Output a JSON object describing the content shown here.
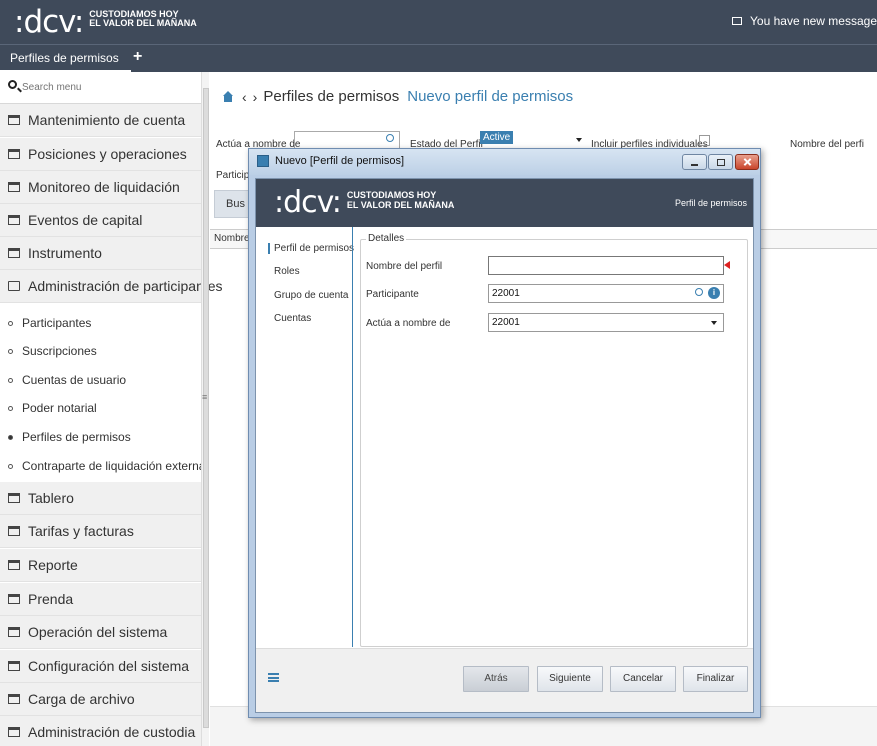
{
  "header": {
    "logo_text": ":dcv:",
    "tagline_line1": "CUSTODIAMOS HOY",
    "tagline_line2": "EL VALOR DEL MAÑANA",
    "messages": "You have new message"
  },
  "tabs": [
    {
      "label": "Perfiles de permisos"
    }
  ],
  "tab_add": "+",
  "sidebar": {
    "search_placeholder": "Search menu",
    "items": [
      {
        "label": "Mantenimiento de cuenta"
      },
      {
        "label": "Posiciones y operaciones"
      },
      {
        "label": "Monitoreo de liquidación"
      },
      {
        "label": "Eventos de capital"
      },
      {
        "label": "Instrumento"
      },
      {
        "label": "Administración de participantes"
      },
      {
        "label": "Tablero"
      },
      {
        "label": "Tarifas y facturas"
      },
      {
        "label": "Reporte"
      },
      {
        "label": "Prenda"
      },
      {
        "label": "Operación del sistema"
      },
      {
        "label": "Configuración del sistema"
      },
      {
        "label": "Carga de archivo"
      },
      {
        "label": "Administración de custodia"
      }
    ],
    "sub_items": [
      {
        "label": "Participantes"
      },
      {
        "label": "Suscripciones"
      },
      {
        "label": "Cuentas de usuario"
      },
      {
        "label": "Poder notarial"
      },
      {
        "label": "Perfiles de permisos",
        "active": true
      },
      {
        "label": "Contraparte de liquidación externa"
      }
    ],
    "scroll_mark": "≡"
  },
  "breadcrumb": {
    "back": "‹",
    "forward": "›",
    "item1": "Perfiles de permisos",
    "item2": "Nuevo perfil de permisos"
  },
  "filters": {
    "actua_label": "Actúa a nombre de",
    "estado_label": "Estado del Perfil",
    "estado_value": "Active",
    "incluir_label": "Incluir perfiles individuales",
    "nombre_label": "Nombre del perfi",
    "participante_label": "Participa",
    "buscar_label": "Bus",
    "grid_col": "Nombre d"
  },
  "dialog": {
    "title": "Nuevo [Perfil de permisos]",
    "section_name": "Perfil de permisos",
    "nav": [
      {
        "label": "Perfil de permisos",
        "active": true
      },
      {
        "label": "Roles"
      },
      {
        "label": "Grupo de cuenta"
      },
      {
        "label": "Cuentas"
      }
    ],
    "fieldset_legend": "Detalles",
    "fields": {
      "nombre_label": "Nombre del perfil",
      "nombre_value": "",
      "participante_label": "Participante",
      "participante_value": "22001",
      "actua_label": "Actúa a nombre de",
      "actua_value": "22001"
    },
    "info_glyph": "i",
    "buttons": {
      "atras": "Atrás",
      "siguiente": "Siguiente",
      "cancelar": "Cancelar",
      "finalizar": "Finalizar"
    }
  }
}
